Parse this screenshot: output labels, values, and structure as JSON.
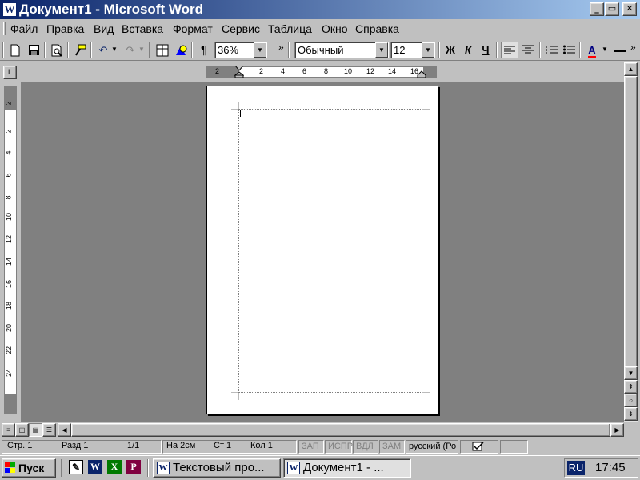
{
  "window": {
    "title": "Документ1 - Microsoft Word",
    "app_icon": "W",
    "minimize": "_",
    "maximize": "▭",
    "close": "✕"
  },
  "menu": [
    "Файл",
    "Правка",
    "Вид",
    "Вставка",
    "Формат",
    "Сервис",
    "Таблица",
    "Окно",
    "Справка"
  ],
  "toolbar": {
    "zoom": "36%",
    "style": "Обычный",
    "font_size": "12",
    "more": "»",
    "bold": "Ж",
    "italic": "К",
    "underline": "Ч",
    "pilcrow": "¶",
    "font_color": "A"
  },
  "ruler": {
    "corner": "L",
    "h_ticks": [
      "2",
      "2",
      "4",
      "6",
      "8",
      "10",
      "12",
      "14",
      "16"
    ],
    "v_ticks": [
      "2",
      "2",
      "4",
      "6",
      "8",
      "10",
      "12",
      "14",
      "16",
      "18",
      "20",
      "22",
      "24"
    ]
  },
  "statusbar": {
    "page": "Стр. 1",
    "section": "Разд 1",
    "pages": "1/1",
    "at": "На 2см",
    "line": "Ст 1",
    "col": "Кол 1",
    "rec": "ЗАП",
    "trk": "ИСПР",
    "ext": "ВДЛ",
    "ovr": "ЗАМ",
    "language": "русский (Ро"
  },
  "taskbar": {
    "start": "Пуск",
    "tasks": [
      "Текстовый про...",
      "Документ1 - ..."
    ],
    "lang": "RU",
    "clock": "17:45"
  },
  "colors": {
    "title_start": "#0a246a",
    "title_end": "#a6caf0",
    "workspace": "#808080",
    "face": "#c0c0c0"
  }
}
